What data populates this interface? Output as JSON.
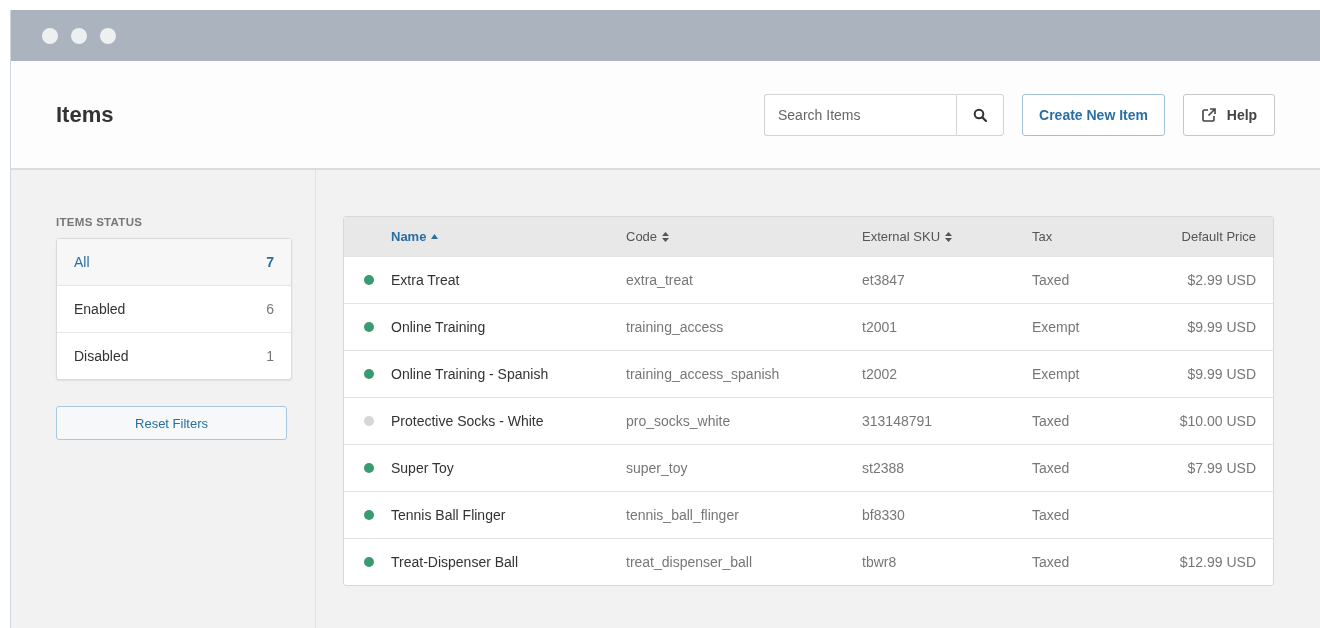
{
  "page": {
    "title": "Items"
  },
  "search": {
    "placeholder": "Search Items"
  },
  "buttons": {
    "create": "Create New Item",
    "help": "Help"
  },
  "sidebar": {
    "heading": "ITEMS STATUS",
    "filters": [
      {
        "label": "All",
        "count": "7",
        "selected": true
      },
      {
        "label": "Enabled",
        "count": "6",
        "selected": false
      },
      {
        "label": "Disabled",
        "count": "1",
        "selected": false
      }
    ],
    "reset": "Reset Filters"
  },
  "table": {
    "columns": [
      {
        "label": "Name",
        "kind": "ascending",
        "selected": true
      },
      {
        "label": "Code",
        "kind": "sortable",
        "selected": false
      },
      {
        "label": "External SKU",
        "kind": "sortable",
        "selected": false
      },
      {
        "label": "Tax",
        "kind": "plain",
        "selected": false
      },
      {
        "label": "Default Price",
        "kind": "plain",
        "selected": false
      }
    ],
    "rows": [
      {
        "enabled": true,
        "name": "Extra Treat",
        "code": "extra_treat",
        "sku": "et3847",
        "tax": "Taxed",
        "price": "$2.99 USD"
      },
      {
        "enabled": true,
        "name": "Online Training",
        "code": "training_access",
        "sku": "t2001",
        "tax": "Exempt",
        "price": "$9.99 USD"
      },
      {
        "enabled": true,
        "name": "Online Training - Spanish",
        "code": "training_access_spanish",
        "sku": "t2002",
        "tax": "Exempt",
        "price": "$9.99 USD"
      },
      {
        "enabled": false,
        "name": "Protective Socks - White",
        "code": "pro_socks_white",
        "sku": "313148791",
        "tax": "Taxed",
        "price": "$10.00 USD"
      },
      {
        "enabled": true,
        "name": "Super Toy",
        "code": "super_toy",
        "sku": "st2388",
        "tax": "Taxed",
        "price": "$7.99 USD"
      },
      {
        "enabled": true,
        "name": "Tennis Ball Flinger",
        "code": "tennis_ball_flinger",
        "sku": "bf8330",
        "tax": "Taxed"
      },
      {
        "enabled": true,
        "name": "Treat-Dispenser Ball",
        "code": "treat_dispenser_ball",
        "sku": "tbwr8",
        "tax": "Taxed",
        "price": "$12.99 USD"
      }
    ]
  }
}
